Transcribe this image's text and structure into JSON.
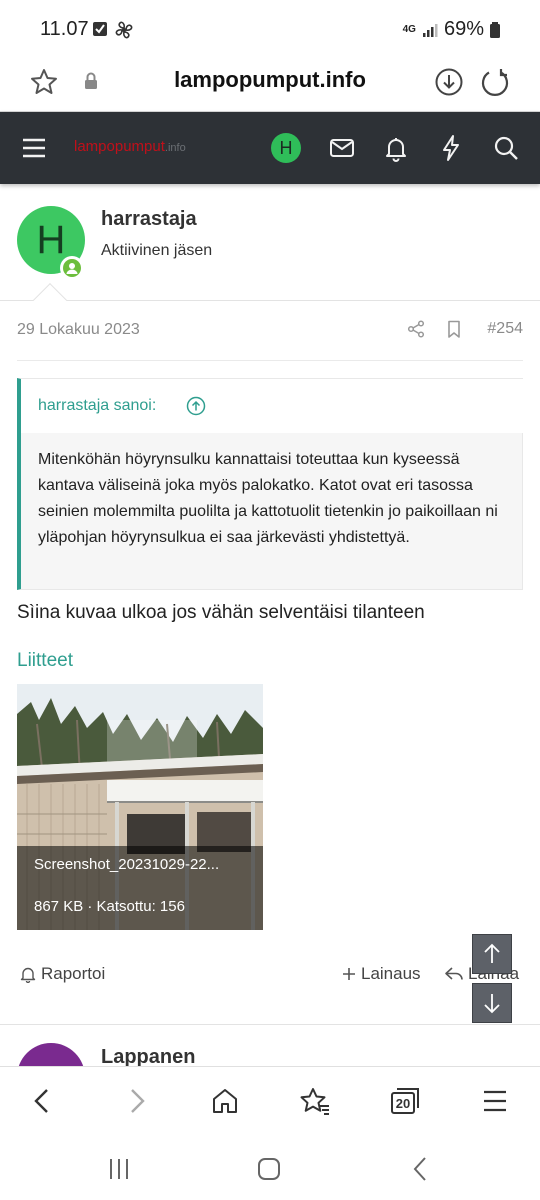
{
  "status_bar": {
    "time": "11.07",
    "network": "4G",
    "battery": "69%"
  },
  "browser": {
    "url": "lampopumput.info"
  },
  "site": {
    "logo_main": "lampopumput",
    "logo_domain": ".info",
    "user_initial": "H"
  },
  "post": {
    "avatar_initial": "H",
    "username": "harrastaja",
    "user_title": "Aktiivinen jäsen",
    "date": "29 Lokakuu 2023",
    "number": "#254",
    "quote_author": "harrastaja sanoi:",
    "quote_text": "Mitenköhän höyrynsulku kannattaisi toteuttaa kun kyseessä kantava väliseinä joka myös palokatko. Katot ovat eri tasossa seinien molemmilta puolilta ja kattotuolit tietenkin jo paikoillaan ni yläpohjan höyrynsulkua ei saa järkevästi yhdistettyä.",
    "message": "Sìina kuvaa ulkoa jos vähän selventäisi tilanteen",
    "attachments_title": "Liitteet",
    "attachment": {
      "filename": "Screenshot_20231029-22...",
      "meta": "867 KB · Katsottu: 156"
    },
    "actions": {
      "report": "Raportoi",
      "multiquote": "Lainaus",
      "reply": "Lainaa"
    }
  },
  "next_post": {
    "username": "Lappanen"
  },
  "bottom_bar": {
    "tabs_count": "20"
  }
}
